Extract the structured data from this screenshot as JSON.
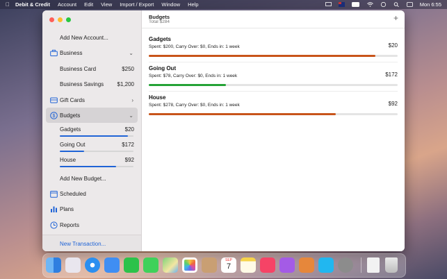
{
  "menubar": {
    "app_name": "Debit & Credit",
    "items": [
      "Account",
      "Edit",
      "View",
      "Import / Export",
      "Window",
      "Help"
    ],
    "clock": "Mon 6:55"
  },
  "sidebar": {
    "add_account": "Add New Account...",
    "business": {
      "label": "Business"
    },
    "business_accounts": [
      {
        "name": "Business Card",
        "amount": "$250"
      },
      {
        "name": "Business Savings",
        "amount": "$1,200"
      }
    ],
    "gift_cards": {
      "label": "Gift Cards"
    },
    "budgets": {
      "label": "Budgets"
    },
    "budget_items": [
      {
        "name": "Gadgets",
        "amount": "$20",
        "progress": 0.92
      },
      {
        "name": "Going Out",
        "amount": "$172",
        "progress": 0.33
      },
      {
        "name": "House",
        "amount": "$92",
        "progress": 0.76
      }
    ],
    "add_budget": "Add New Budget...",
    "scheduled": {
      "label": "Scheduled"
    },
    "plans": {
      "label": "Plans"
    },
    "reports": {
      "label": "Reports"
    },
    "new_transaction": "New Transaction..."
  },
  "main": {
    "title": "Budgets",
    "subtitle": "Total $284",
    "budgets": [
      {
        "name": "Gadgets",
        "info": "Spent: $200, Carry Over: $0, Ends in: 1 week",
        "amount": "$20",
        "progress": 0.91,
        "color": "#c8541a"
      },
      {
        "name": "Going Out",
        "info": "Spent: $78, Carry Over: $0, Ends in: 1 week",
        "amount": "$172",
        "progress": 0.31,
        "color": "#25a336"
      },
      {
        "name": "House",
        "info": "Spent: $278, Carry Over: $0, Ends in: 1 week",
        "amount": "$92",
        "progress": 0.75,
        "color": "#c8541a"
      }
    ]
  },
  "colors": {
    "accent": "#1f63d6",
    "over_budget": "#c8541a",
    "under_budget": "#25a336"
  },
  "dock": {
    "apps": [
      "finder-icon",
      "launchpad-icon",
      "safari-icon",
      "mail-icon",
      "facetime-icon",
      "messages-icon",
      "maps-icon",
      "photos-icon",
      "contacts-icon",
      "calendar-icon",
      "notes-icon",
      "music-icon",
      "podcasts-icon",
      "debit-credit-icon",
      "app-store-icon",
      "system-preferences-icon"
    ],
    "calendar": {
      "month": "SEP",
      "day": "7"
    }
  }
}
